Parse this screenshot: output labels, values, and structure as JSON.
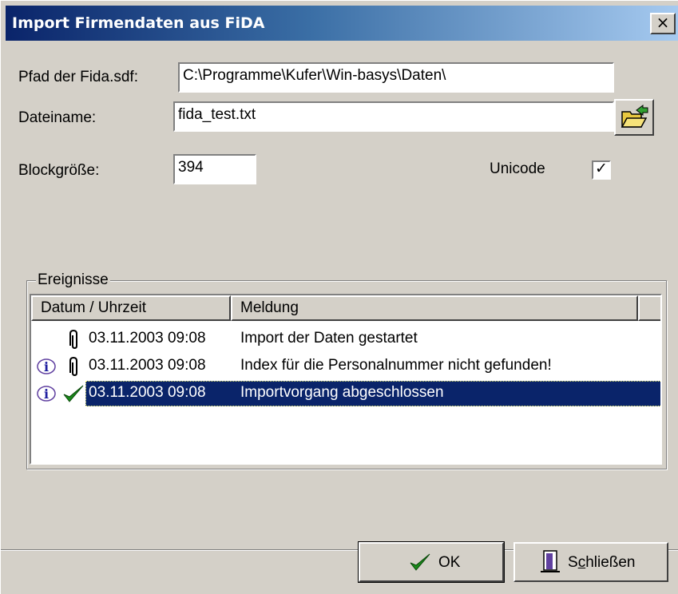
{
  "window": {
    "title": "Import Firmendaten aus FiDA",
    "close_label": "×"
  },
  "form": {
    "path_label": "Pfad der Fida.sdf:",
    "path_value": "C:\\Programme\\Kufer\\Win-basys\\Daten\\",
    "file_label": "Dateiname:",
    "file_value": "fida_test.txt",
    "block_label": "Blockgröße:",
    "block_value": "394",
    "unicode_label": "Unicode",
    "unicode_checked": true,
    "unicode_mark": "✓"
  },
  "events": {
    "group_title": "Ereignisse",
    "columns": [
      "Datum / Uhrzeit",
      "Meldung"
    ],
    "rows": [
      {
        "date": "03.11.2003 09:08",
        "message": "Import der Daten gestartet",
        "icons": [
          "paperclip-icon"
        ],
        "selected": false
      },
      {
        "date": "03.11.2003 09:08",
        "message": "Index für die Personalnummer nicht gefunden!",
        "icons": [
          "info-icon",
          "paperclip-icon"
        ],
        "selected": false
      },
      {
        "date": "03.11.2003 09:08",
        "message": "Importvorgang abgeschlossen",
        "icons": [
          "info-icon",
          "checkmark-icon"
        ],
        "selected": true
      }
    ]
  },
  "buttons": {
    "ok_label": "OK",
    "close_label_pre": "S",
    "close_label_ul": "c",
    "close_label_post": "hließen"
  },
  "colors": {
    "title_gradient_start": "#0a246a",
    "title_gradient_end": "#a6caf0",
    "selection": "#0a246a",
    "face": "#d4d0c8"
  }
}
